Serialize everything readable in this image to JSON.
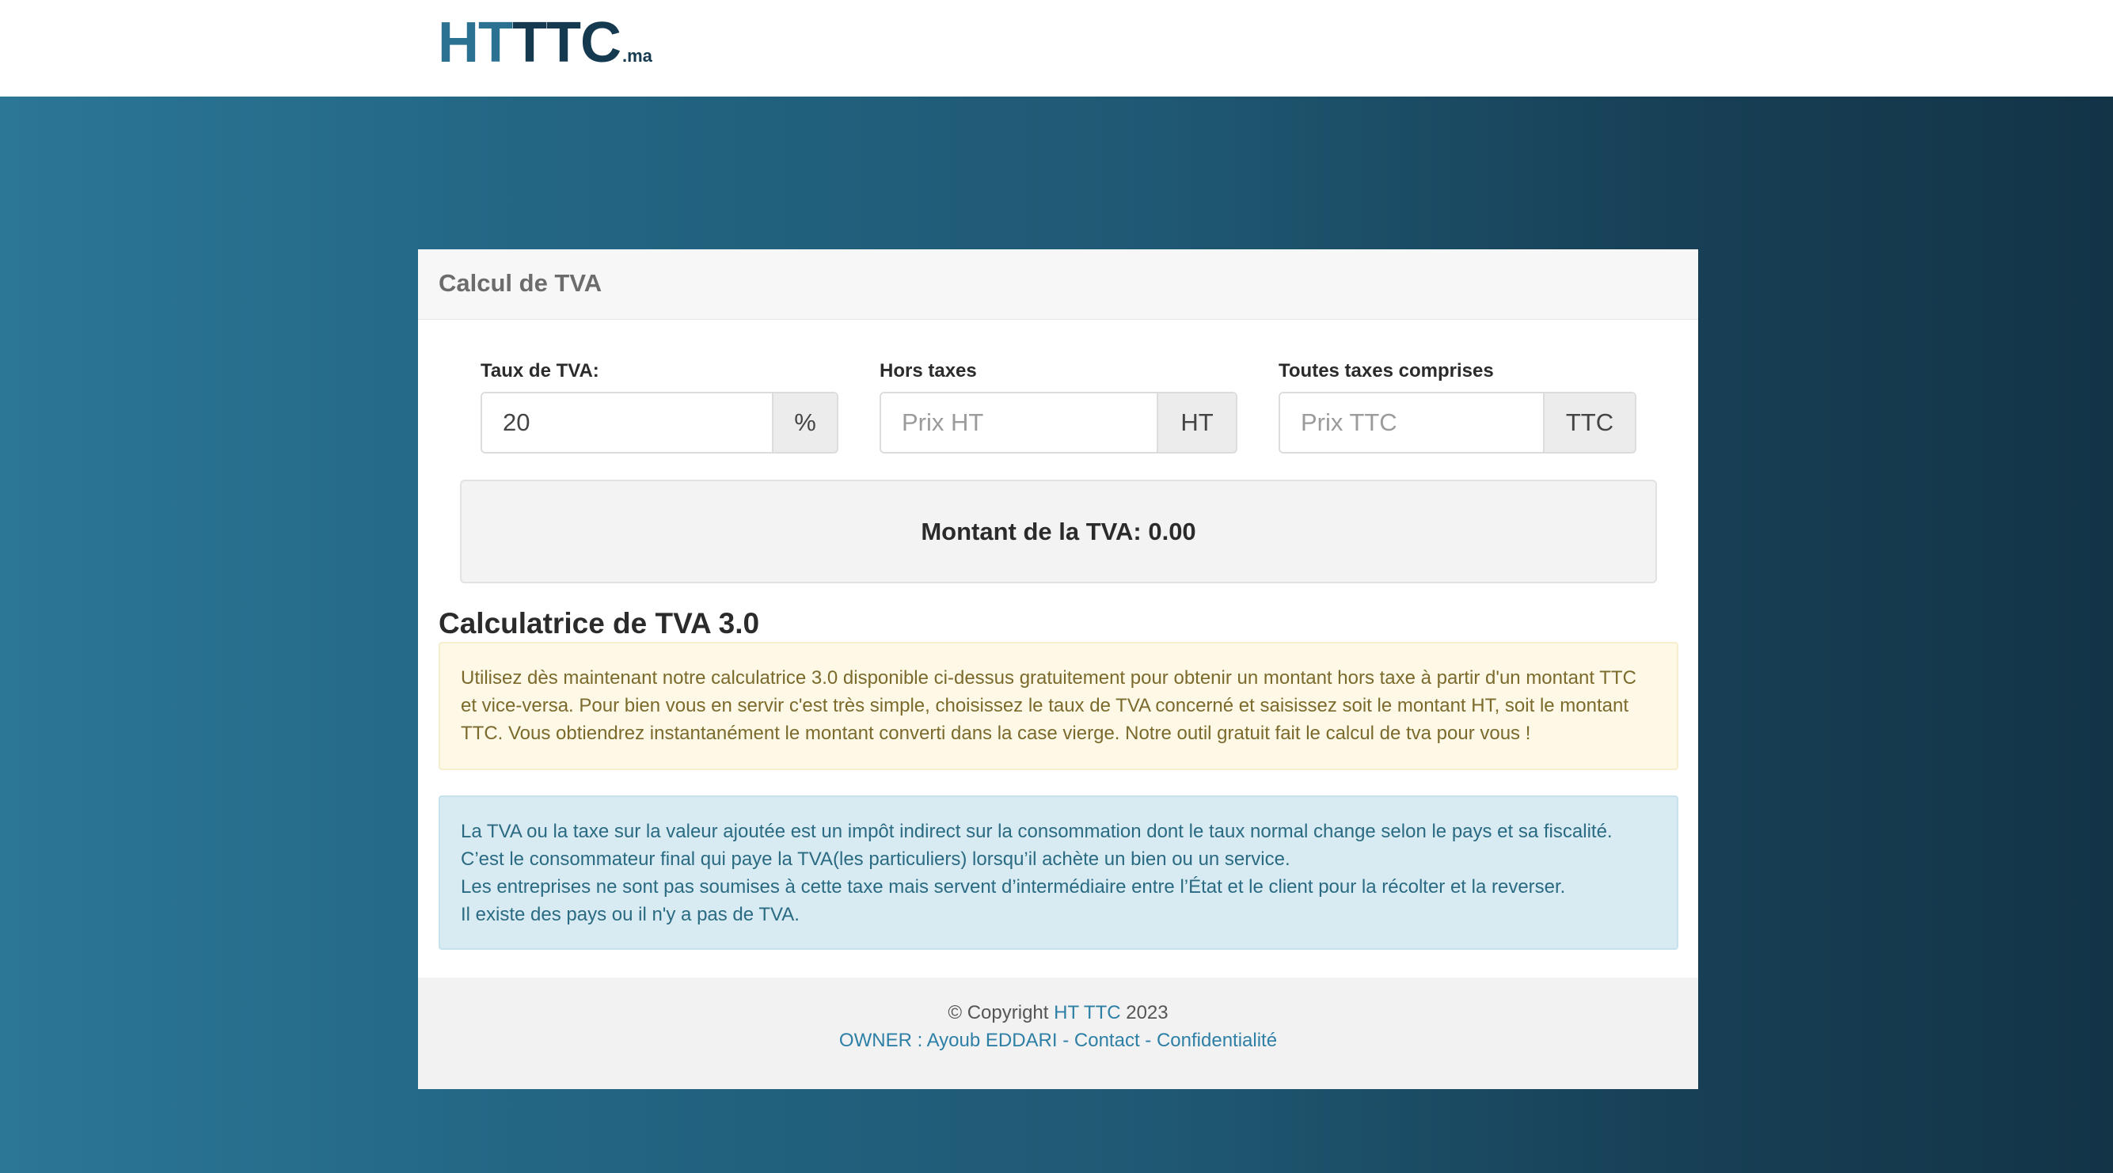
{
  "brand": {
    "logo_ht": "HT",
    "logo_ttc": "TTC",
    "logo_suffix": ".ma",
    "colors": {
      "accent": "#2b7191",
      "dark": "#153a4f"
    }
  },
  "card": {
    "title": "Calcul de TVA"
  },
  "fields": {
    "rate": {
      "label": "Taux de TVA:",
      "value": "20",
      "placeholder": "",
      "addon": "%"
    },
    "ht": {
      "label": "Hors taxes",
      "value": "",
      "placeholder": "Prix HT",
      "addon": "HT"
    },
    "ttc": {
      "label": "Toutes taxes comprises",
      "value": "",
      "placeholder": "Prix TTC",
      "addon": "TTC"
    }
  },
  "result": {
    "label": "Montant de la TVA: 0.00"
  },
  "section": {
    "title": "Calculatrice de TVA 3.0",
    "warning_text": "Utilisez dès maintenant notre calculatrice 3.0 disponible ci-dessus gratuitement pour obtenir un montant hors taxe à partir d'un montant TTC et vice-versa. Pour bien vous en servir c'est très simple, choisissez le taux de TVA concerné et saisissez soit le montant HT, soit le montant TTC. Vous obtiendrez instantanément le montant converti dans la case vierge. Notre outil gratuit fait le calcul de tva pour vous !",
    "info_lines": [
      "La TVA ou la taxe sur la valeur ajoutée est un impôt indirect sur la consommation dont le taux normal change selon le pays et sa fiscalité.",
      "C’est le consommateur final qui paye la TVA(les particuliers) lorsqu’il achète un bien ou un service.",
      "Les entreprises ne sont pas soumises à cette taxe mais servent d’intermédiaire entre l’État et le client pour la récolter et la reverser.",
      "Il existe des pays ou il n'y a pas de TVA."
    ]
  },
  "footer": {
    "copyright_prefix": "© Copyright",
    "copyright_link": "HT TTC",
    "copyright_year": "2023",
    "owner_link": "OWNER : Ayoub EDDARI",
    "sep1": "-",
    "contact_link": "Contact",
    "sep2": "-",
    "privacy_link": "Confidentialité"
  }
}
